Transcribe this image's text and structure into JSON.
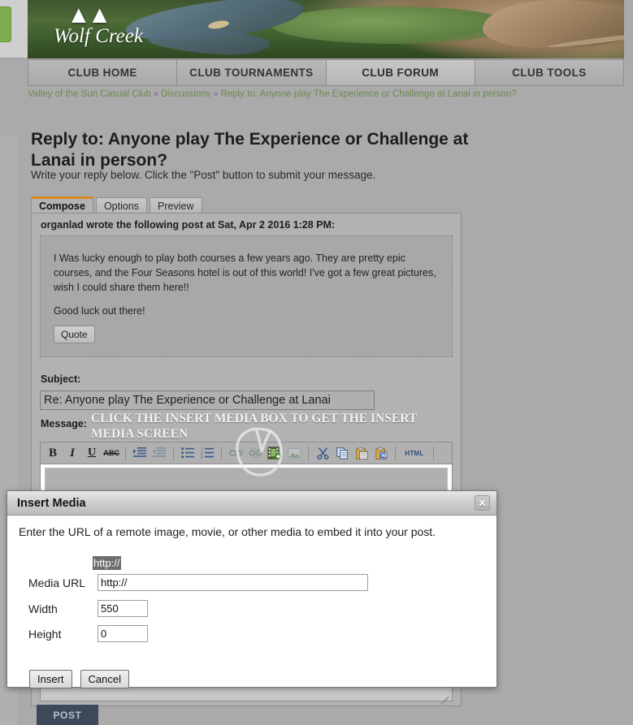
{
  "banner": {
    "logo_wordmark": "Wolf Creek",
    "logo_mark": " "
  },
  "clubnav": {
    "tabs": [
      {
        "label": "CLUB HOME",
        "active": false
      },
      {
        "label": "CLUB TOURNAMENTS",
        "active": false
      },
      {
        "label": "CLUB FORUM",
        "active": true
      },
      {
        "label": "CLUB TOOLS",
        "active": false
      }
    ]
  },
  "breadcrumb": {
    "club": "Valley of the Sun Casual Club",
    "sep": "»",
    "section": "Discussions",
    "current": "Reply to: Anyone play The Experience or Challenge at Lanai in person?"
  },
  "page": {
    "title": "Reply to: Anyone play The Experience or Challenge at Lanai in person?",
    "subtitle": "Write your reply below. Click the \"Post\" button to submit your message."
  },
  "compose_tabs": [
    {
      "label": "Compose",
      "active": true
    },
    {
      "label": "Options",
      "active": false
    },
    {
      "label": "Preview",
      "active": false
    }
  ],
  "quote": {
    "header": "organlad wrote the following post at Sat, Apr 2 2016 1:28 PM:",
    "paragraphs": [
      "I Was lucky enough to play both courses a few years ago. They are pretty epic courses, and the Four Seasons hotel is out of this world! I've got a few great pictures, wish I could share them here!!",
      "Good luck out there!"
    ],
    "quote_button": "Quote"
  },
  "form": {
    "subject_label": "Subject:",
    "subject_value": "Re: Anyone play The Experience or Challenge at Lanai",
    "message_label": "Message:"
  },
  "toolbar": {
    "buttons": [
      {
        "name": "bold-icon",
        "glyph": "B",
        "style": "b",
        "dim": false
      },
      {
        "name": "italic-icon",
        "glyph": "I",
        "style": "i",
        "dim": false
      },
      {
        "name": "underline-icon",
        "glyph": "U",
        "style": "u",
        "dim": false
      },
      {
        "name": "strikethrough-icon",
        "glyph": "ABC",
        "style": "s",
        "dim": false
      },
      {
        "name": "separator",
        "glyph": "",
        "style": "sep",
        "dim": false
      },
      {
        "name": "indent-increase-icon",
        "glyph": "",
        "style": "indent-in",
        "dim": false
      },
      {
        "name": "indent-decrease-icon",
        "glyph": "",
        "style": "indent-out",
        "dim": true
      },
      {
        "name": "separator",
        "glyph": "",
        "style": "sep",
        "dim": false
      },
      {
        "name": "bullet-list-icon",
        "glyph": "",
        "style": "ul",
        "dim": false
      },
      {
        "name": "numbered-list-icon",
        "glyph": "",
        "style": "ol",
        "dim": false
      },
      {
        "name": "separator",
        "glyph": "",
        "style": "sep",
        "dim": false
      },
      {
        "name": "insert-link-icon",
        "glyph": "",
        "style": "link",
        "dim": true
      },
      {
        "name": "remove-link-icon",
        "glyph": "",
        "style": "unlink",
        "dim": true
      },
      {
        "name": "insert-media-icon",
        "glyph": "",
        "style": "media",
        "dim": false
      },
      {
        "name": "insert-image-icon",
        "glyph": "",
        "style": "image",
        "dim": true
      },
      {
        "name": "separator",
        "glyph": "",
        "style": "sep",
        "dim": false
      },
      {
        "name": "cut-icon",
        "glyph": "",
        "style": "cut",
        "dim": false
      },
      {
        "name": "copy-icon",
        "glyph": "",
        "style": "copy",
        "dim": false
      },
      {
        "name": "paste-icon",
        "glyph": "",
        "style": "paste",
        "dim": false
      },
      {
        "name": "paste-from-word-icon",
        "glyph": "",
        "style": "word",
        "dim": false
      },
      {
        "name": "separator",
        "glyph": "",
        "style": "sep",
        "dim": false
      },
      {
        "name": "html-source-icon",
        "glyph": "HTML",
        "style": "html",
        "dim": false
      },
      {
        "name": "separator",
        "glyph": "",
        "style": "sep",
        "dim": false
      }
    ]
  },
  "annotation": {
    "text": "CLICK THE INSERT MEDIA BOX TO GET THE INSERT MEDIA SCREEN"
  },
  "post_button": {
    "label": "POST"
  },
  "dialog": {
    "title": "Insert Media",
    "close_glyph": "✕",
    "description": "Enter the URL of a remote image, movie, or other media to embed it into your post.",
    "fields": [
      {
        "label": "Media URL",
        "value": "http://",
        "selected": true
      },
      {
        "label": "Width",
        "value": "550",
        "selected": false
      },
      {
        "label": "Height",
        "value": "0",
        "selected": false
      }
    ],
    "url_label": "Media URL",
    "url_value": "http://",
    "width_label": "Width",
    "width_value": "550",
    "height_label": "Height",
    "height_value": "0",
    "insert_label": "Insert",
    "cancel_label": "Cancel"
  },
  "colors": {
    "page_bg": "#aaaaaa",
    "accent_tab": "#d68a1e",
    "breadcrumb_link": "#6e8a4e",
    "post_button_bg": "#3d4858",
    "selection_bg": "#6d6d6d"
  }
}
